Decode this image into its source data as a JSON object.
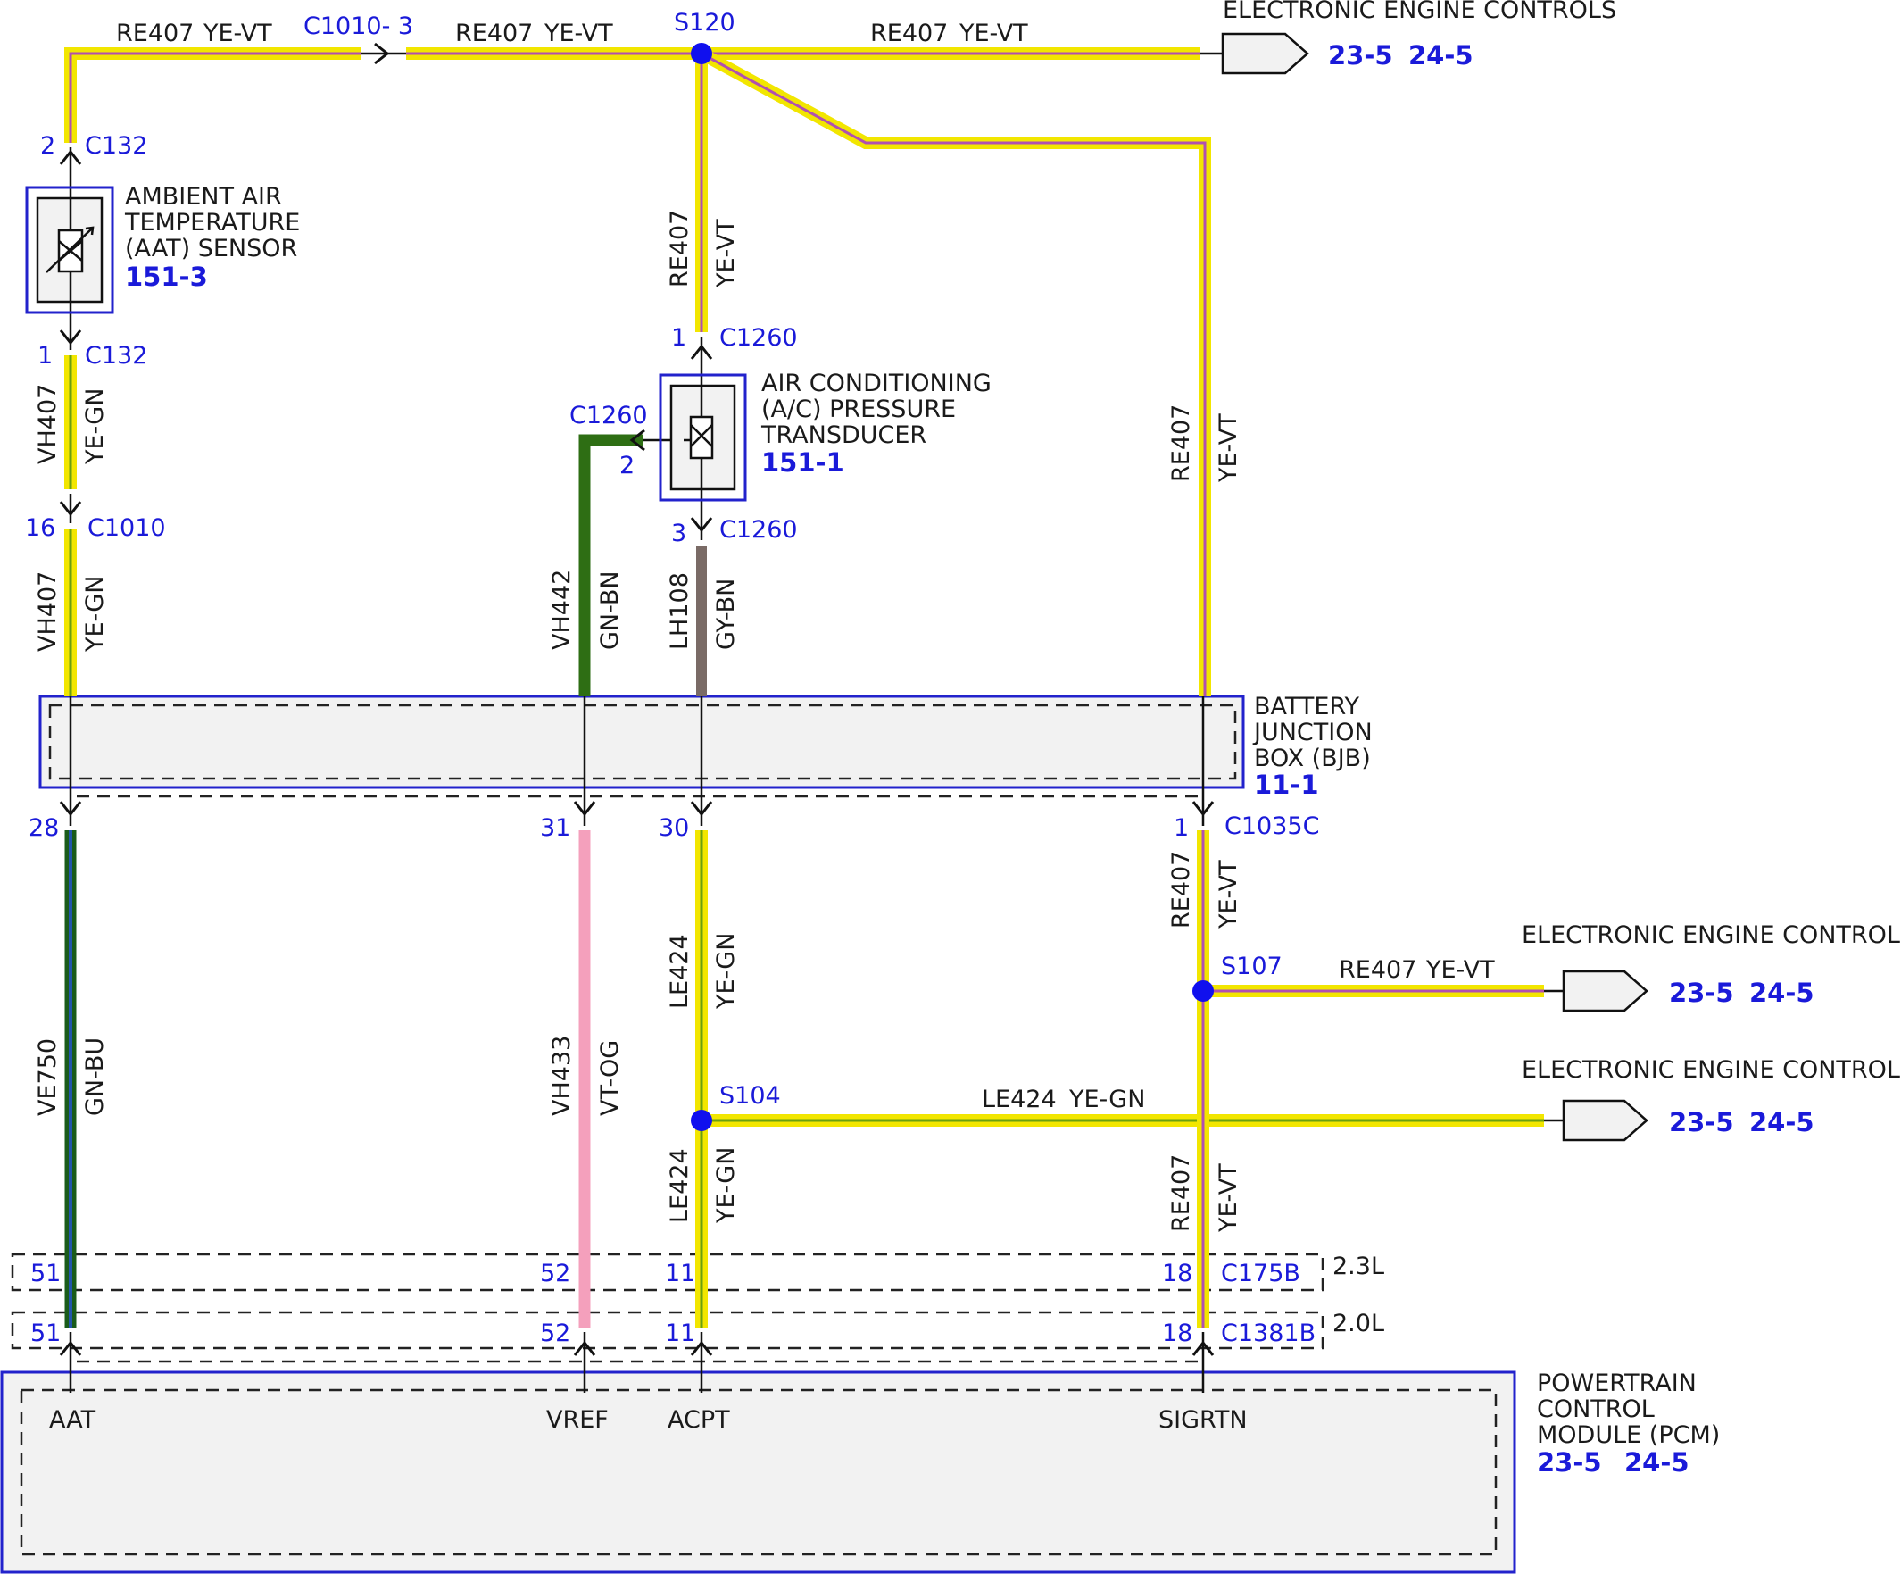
{
  "colors": {
    "yellow": "#f2e600",
    "violet": "#c060c0",
    "green": "#2e6e14",
    "green_light": "#9ee020",
    "blue": "#2255aa",
    "brown": "#8b5a2b",
    "gray": "#7a7a7a",
    "pink": "#f4a0bc",
    "node": "#1010ee",
    "accent": "#1a1ad9"
  },
  "wires_top": {
    "c1010_3": "C1010- 3",
    "seg1_circuit": "RE407",
    "seg1_color": "YE-VT",
    "seg2_circuit": "RE407",
    "seg2_color": "YE-VT",
    "s120": "S120",
    "seg3_circuit": "RE407",
    "seg3_color": "YE-VT"
  },
  "eec_top": {
    "label": "ELECTRONIC ENGINE CONTROLS",
    "ref1": "23-5",
    "ref2": "24-5"
  },
  "aat_sensor": {
    "line1": "AMBIENT AIR",
    "line2": "TEMPERATURE",
    "line3": "(AAT) SENSOR",
    "ref": "151-3",
    "pin_top": "2",
    "conn_top": "C132",
    "pin_bot": "1",
    "conn_bot": "C132"
  },
  "aat_wire1": {
    "circuit": "VH407",
    "color": "YE-GN"
  },
  "c1010": {
    "pin": "16",
    "conn": "C1010"
  },
  "aat_wire2": {
    "circuit": "VH407",
    "color": "YE-GN"
  },
  "ac_transducer": {
    "line1": "AIR CONDITIONING",
    "line2": "(A/C) PRESSURE",
    "line3": "TRANSDUCER",
    "ref": "151-1",
    "pin1": "1",
    "conn1": "C1260",
    "pin2": "2",
    "conn2": "C1260",
    "pin3": "3",
    "conn3": "C1260"
  },
  "ac_supply_wire": {
    "circuit": "RE407",
    "color": "YE-VT"
  },
  "right_riser": {
    "circuit": "RE407",
    "color": "YE-VT"
  },
  "vh442": {
    "circuit": "VH442",
    "color": "GN-BN"
  },
  "lh108": {
    "circuit": "LH108",
    "color": "GY-BN"
  },
  "bjb": {
    "line1": "BATTERY",
    "line2": "JUNCTION",
    "line3": "BOX (BJB)",
    "ref": "11-1"
  },
  "bjb_pins": {
    "p28": "28",
    "p31": "31",
    "p30": "30",
    "p1": "1",
    "c1035c": "C1035C"
  },
  "ve750": {
    "circuit": "VE750",
    "color": "GN-BU"
  },
  "vh433": {
    "circuit": "VH433",
    "color": "VT-OG"
  },
  "le424_top": {
    "circuit": "LE424",
    "color": "YE-GN"
  },
  "le424_bot": {
    "circuit": "LE424",
    "color": "YE-GN"
  },
  "re407_r1": {
    "circuit": "RE407",
    "color": "YE-VT"
  },
  "re407_r2": {
    "circuit": "RE407",
    "color": "YE-VT"
  },
  "s107": "S107",
  "s104": "S104",
  "s107_wire": {
    "circuit": "RE407",
    "color": "YE-VT"
  },
  "s104_wire": {
    "circuit": "LE424",
    "color": "YE-GN"
  },
  "eec_mid1": {
    "label": "ELECTRONIC ENGINE CONTROLS",
    "ref1": "23-5",
    "ref2": "24-5"
  },
  "eec_mid2": {
    "label": "ELECTRONIC ENGINE CONTROLS",
    "ref1": "23-5",
    "ref2": "24-5"
  },
  "row_23": {
    "p51": "51",
    "p52": "52",
    "p11": "11",
    "p18": "18",
    "conn": "C175B",
    "engine": "2.3L"
  },
  "row_20": {
    "p51": "51",
    "p52": "52",
    "p11": "11",
    "p18": "18",
    "conn": "C1381B",
    "engine": "2.0L"
  },
  "pcm": {
    "line1": "POWERTRAIN",
    "line2": "CONTROL",
    "line3": "MODULE (PCM)",
    "ref1": "23-5",
    "ref2": "24-5",
    "pin_aat": "AAT",
    "pin_vref": "VREF",
    "pin_acpt": "ACPT",
    "pin_sigrtn": "SIGRTN"
  }
}
